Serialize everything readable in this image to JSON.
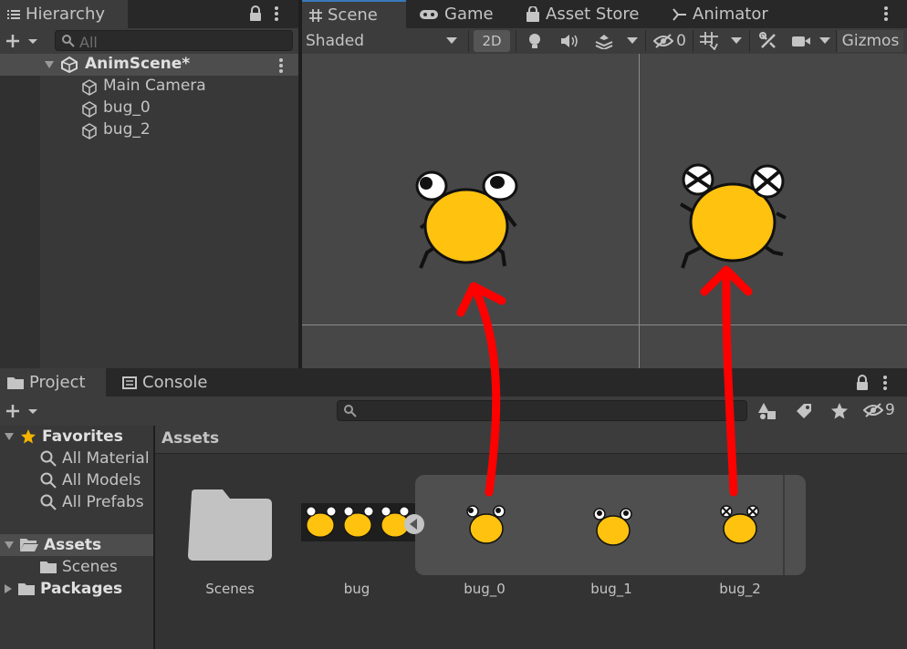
{
  "hierarchy": {
    "tab_label": "Hierarchy",
    "search_placeholder": "All",
    "scene_name": "AnimScene*",
    "objects": [
      "Main Camera",
      "bug_0",
      "bug_2"
    ]
  },
  "scene_tabs": {
    "scene": "Scene",
    "game": "Game",
    "asset_store": "Asset Store",
    "animator": "Animator"
  },
  "scene_toolbar": {
    "shading_mode": "Shaded",
    "two_d": "2D",
    "hidden_count": "0",
    "gizmos": "Gizmos"
  },
  "project": {
    "tab_project": "Project",
    "tab_console": "Console",
    "hidden_count": "9",
    "favorites": {
      "label": "Favorites",
      "items": [
        "All Material",
        "All Models",
        "All Prefabs"
      ]
    },
    "tree": {
      "assets": "Assets",
      "scenes": "Scenes",
      "packages": "Packages"
    },
    "breadcrumb": "Assets",
    "assets": {
      "scenes_folder": "Scenes",
      "bug_sheet": "bug",
      "bug_0": "bug_0",
      "bug_1": "bug_1",
      "bug_2": "bug_2"
    }
  },
  "colors": {
    "accent": "#3a79bb",
    "bug_body": "#ffc20e",
    "arrow": "#ff0000"
  }
}
